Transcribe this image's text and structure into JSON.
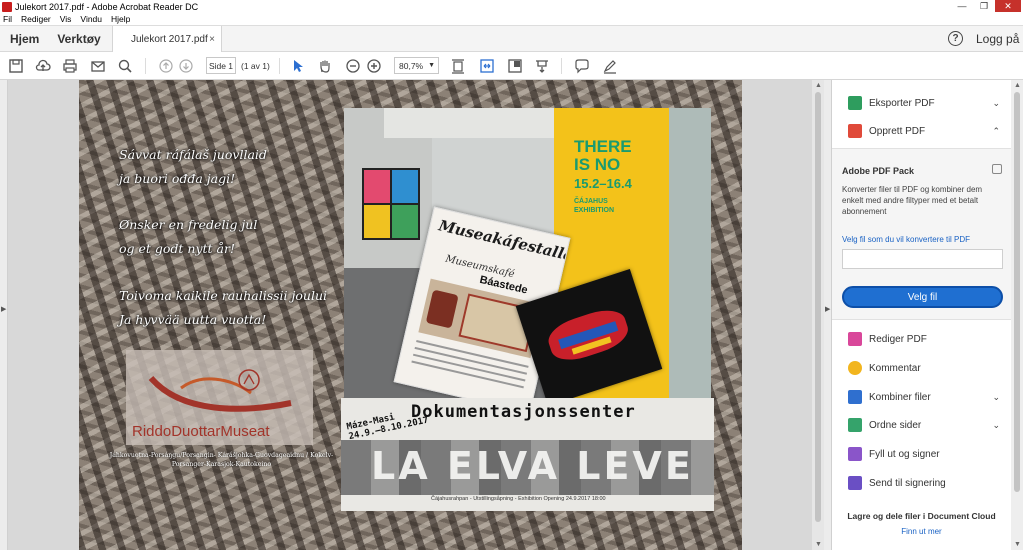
{
  "window": {
    "title": "Julekort 2017.pdf - Adobe Acrobat Reader DC",
    "minimize": "—",
    "maximize": "❐",
    "close": "✕"
  },
  "menu": [
    "Fil",
    "Rediger",
    "Vis",
    "Vindu",
    "Hjelp"
  ],
  "tabs": {
    "home": "Hjem",
    "tools": "Verktøy",
    "document": "Julekort 2017.pdf",
    "close": "×"
  },
  "header": {
    "help": "?",
    "login": "Logg på"
  },
  "toolbar": {
    "page_value": "Side 1",
    "page_count": "(1 av 1)",
    "zoom_value": "80,7%"
  },
  "document": {
    "greetings": [
      [
        "Sávvat ráfálaš juovllaid",
        "ja buori ođđa jagi!"
      ],
      [
        "Ønsker en fredelig jul",
        "og et godt nytt år!"
      ],
      [
        "Toivoma kaikile rauhalissii joului",
        "Ja hyvvää uutta vuotta!"
      ]
    ],
    "logo_name": "RiddoDuottarMuseat",
    "address": "Jáhkovuotna-Porsáŋgu/Porsangin- Kárášjohka-Guovdageaidnu / Kokelv-Porsanger-Karasjok-Kautokeino",
    "exhibit": {
      "line1": "THERE",
      "line2": "IS NO",
      "dates": "15.2–16.4",
      "caption1": "ČÁJAHUS",
      "caption2": "EXHIBITION"
    },
    "poster": {
      "title1": "Museakáfestallan",
      "subtitle": "Museumskafé",
      "place": "Báastede"
    },
    "banner": {
      "title": "Dokumentasjonssenter",
      "maze1": "Máze-Masi",
      "maze2": "24.9.–8.10.2017",
      "rock_text": "LA ELVA LEVE",
      "footer": "Čájahusrahpan - Utstillingsåpning - Exhibition Opening 24.9.2017  18:00"
    }
  },
  "panel": {
    "export_pdf": "Eksporter PDF",
    "create_pdf": "Opprett PDF",
    "pack_title": "Adobe PDF Pack",
    "pack_desc": "Konverter filer til PDF og kombiner dem enkelt med andre filtyper med et betalt abonnement",
    "pack_link": "Velg fil som du vil konvertere til PDF",
    "choose_file": "Velg fil",
    "edit_pdf": "Rediger PDF",
    "comment": "Kommentar",
    "combine": "Kombiner filer",
    "organize": "Ordne sider",
    "fill_sign": "Fyll ut og signer",
    "send_sign": "Send til signering",
    "cloud_title": "Lagre og dele filer i Document Cloud",
    "cloud_link": "Finn ut mer"
  },
  "colors": {
    "accent": "#1f6fd1",
    "brand_red": "#c81e1e",
    "exhibit_green": "#1a9b6f",
    "exhibit_yellow": "#f3c21a"
  }
}
